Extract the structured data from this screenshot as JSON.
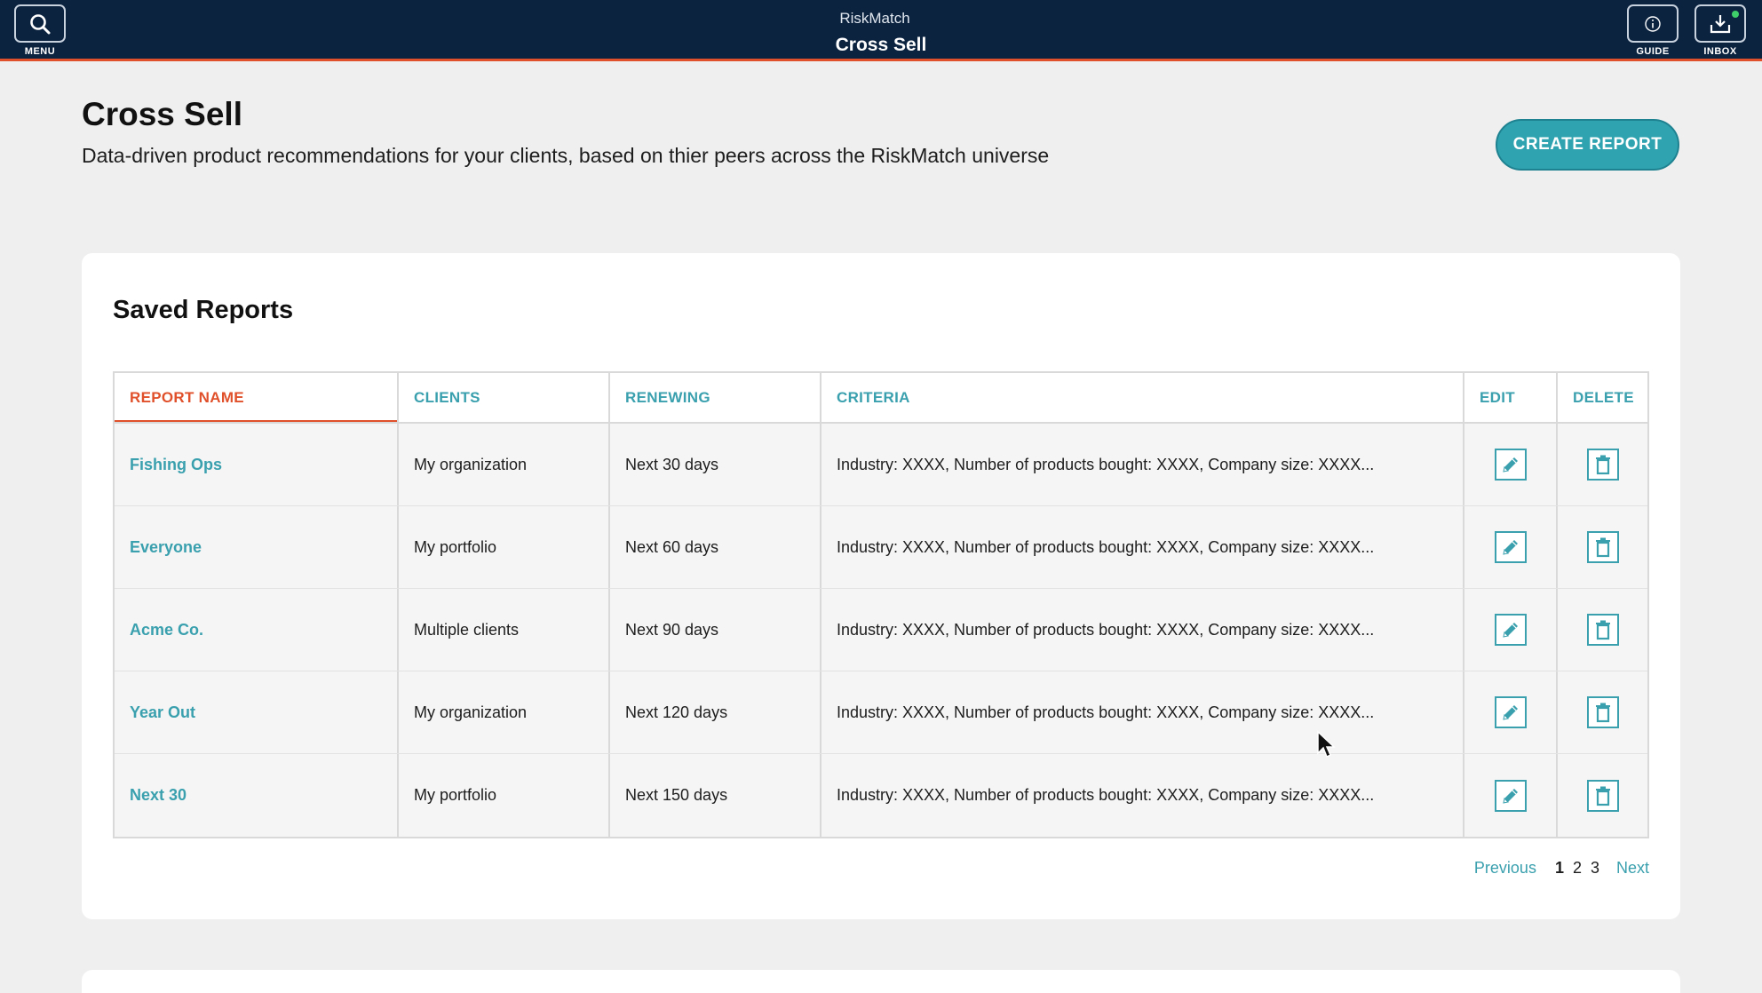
{
  "topbar": {
    "menu_label": "MENU",
    "app_name": "RiskMatch",
    "page_name": "Cross Sell",
    "guide_label": "GUIDE",
    "inbox_label": "INBOX",
    "inbox_has_notification": true
  },
  "header": {
    "title": "Cross Sell",
    "subtitle": "Data-driven product recommendations for your clients, based on thier peers across the RiskMatch universe",
    "create_button": "CREATE REPORT"
  },
  "saved_reports": {
    "title": "Saved Reports",
    "columns": [
      "REPORT NAME",
      "CLIENTS",
      "RENEWING",
      "CRITERIA",
      "EDIT",
      "DELETE"
    ],
    "sorted_column": "REPORT NAME",
    "rows": [
      {
        "name": "Fishing Ops",
        "clients": "My organization",
        "renewing": "Next 30 days",
        "criteria": "Industry: XXXX, Number of products bought: XXXX, Company size: XXXX..."
      },
      {
        "name": "Everyone",
        "clients": "My portfolio",
        "renewing": "Next 60 days",
        "criteria": "Industry: XXXX, Number of products bought: XXXX, Company size: XXXX..."
      },
      {
        "name": "Acme Co.",
        "clients": "Multiple clients",
        "renewing": "Next 90 days",
        "criteria": "Industry: XXXX, Number of products bought: XXXX, Company size: XXXX..."
      },
      {
        "name": "Year Out",
        "clients": "My organization",
        "renewing": "Next 120 days",
        "criteria": "Industry: XXXX, Number of products bought: XXXX, Company size: XXXX..."
      },
      {
        "name": "Next 30",
        "clients": "My portfolio",
        "renewing": "Next 150 days",
        "criteria": "Industry: XXXX, Number of products bought: XXXX, Company size: XXXX..."
      }
    ],
    "pagination": {
      "previous": "Previous",
      "pages": [
        "1",
        "2",
        "3"
      ],
      "current": "1",
      "next": "Next"
    }
  },
  "colors": {
    "topbar": "#0c2340",
    "accent": "#3aa0ae",
    "sort_highlight": "#e0502a",
    "button": "#2fa3b0"
  },
  "icons": {
    "menu": "search-icon",
    "guide": "info-icon",
    "inbox": "download-tray-icon",
    "edit": "pencil-icon",
    "delete": "trash-icon"
  }
}
